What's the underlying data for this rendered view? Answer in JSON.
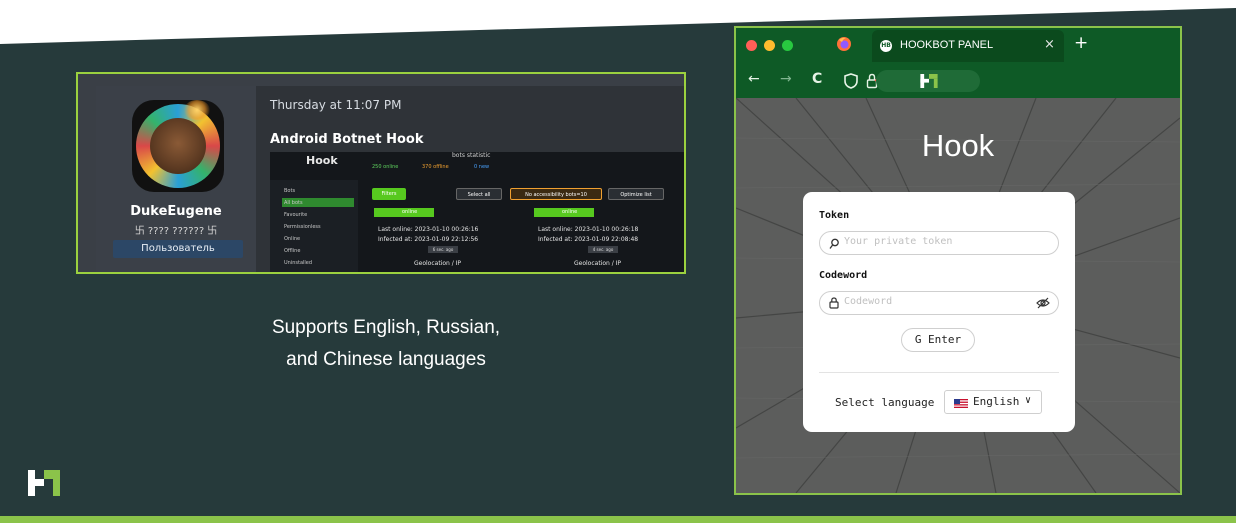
{
  "caption": {
    "line1": "Supports English, Russian,",
    "line2": "and Chinese languages"
  },
  "forum": {
    "post_date": "Thursday at 11:07 PM",
    "post_title": "Android Botnet Hook",
    "username": "DukeEugene",
    "user_title": "卐 ???? ?????? 卐",
    "user_badge": "Пользователь",
    "panel": {
      "logo": "Hook",
      "stats_label": "bots statistic",
      "stats": [
        "250 online",
        "370 offline",
        "0 new"
      ],
      "sidebar": [
        "Bots",
        "All bots",
        "Favourite",
        "Permissionless",
        "Online",
        "Offline",
        "Uninstalled"
      ],
      "toolbar": [
        "Filters",
        "Select all",
        "No accessibility bots=10",
        "Optimize list"
      ],
      "cards": [
        {
          "status": "online",
          "last_online": "Last online: 2023-01-10 00:26:16",
          "infected": "Infected at: 2023-01-09 22:12:56",
          "ago": "6 sec. ago",
          "geo": "Geolocation / IP"
        },
        {
          "status": "online",
          "last_online": "Last online: 2023-01-10 00:26:18",
          "infected": "Infected at: 2023-01-09 22:08:48",
          "ago": "4 sec. ago",
          "geo": "Geolocation / IP"
        }
      ]
    }
  },
  "browser": {
    "tab_title": "HOOKBOT PANEL",
    "tab_close": "×",
    "new_tab": "+",
    "nav": {
      "back": "←",
      "forward": "→",
      "reload": "C"
    },
    "page_title": "Hook",
    "token_label": "Token",
    "token_placeholder": "Your private token",
    "codeword_label": "Codeword",
    "codeword_placeholder": "Codeword",
    "enter_label": "G Enter",
    "select_language_label": "Select language",
    "language_value": "English"
  },
  "colors": {
    "background": "#263a3b",
    "accent": "#8bc34a",
    "browser_chrome": "#0e5a26"
  }
}
